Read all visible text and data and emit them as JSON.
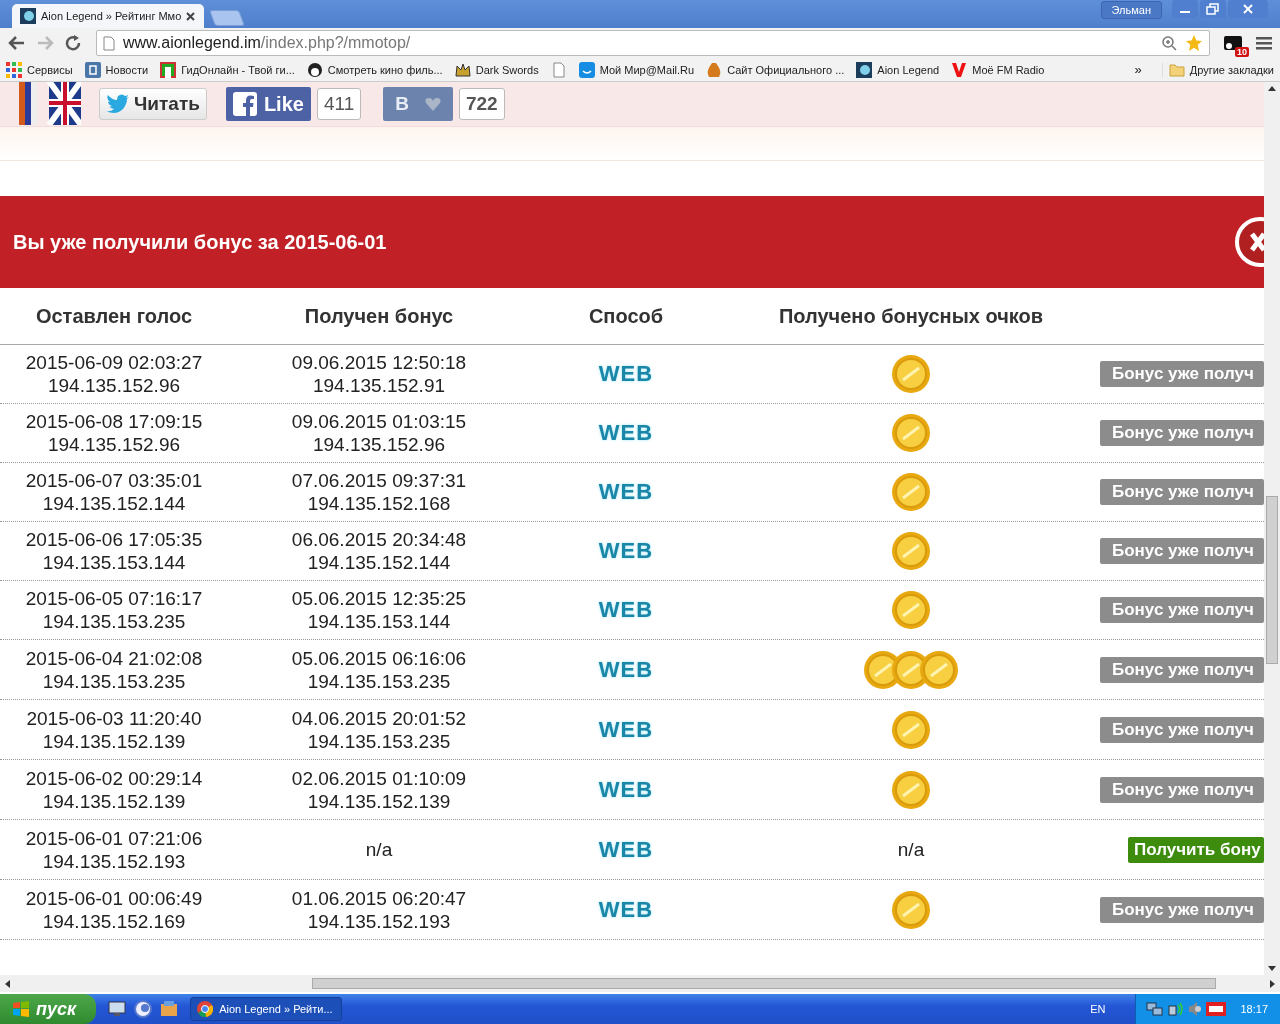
{
  "window": {
    "tab_title": "Aion Legend » Рейтинг Ммо",
    "user": "Эльман"
  },
  "toolbar": {
    "url_host": "www.aionlegend.im",
    "url_path": "/index.php?/mmotop/",
    "extension_badge": "10"
  },
  "bookmarks": [
    {
      "kind": "link",
      "label": "Сервисы"
    },
    {
      "kind": "link",
      "label": "Новости"
    },
    {
      "kind": "link",
      "label": "ГидОнлайн - Твой ги..."
    },
    {
      "kind": "link",
      "label": "Смотреть кино филь..."
    },
    {
      "kind": "link",
      "label": "Dark Swords"
    },
    {
      "kind": "icon"
    },
    {
      "kind": "link",
      "label": "Мой Мир@Mail.Ru"
    },
    {
      "kind": "link",
      "label": "Сайт Официального ..."
    },
    {
      "kind": "link",
      "label": "Aion Legend"
    },
    {
      "kind": "link",
      "label": "Моё  FM Radio"
    }
  ],
  "bookmarks_more": "»",
  "other_bookmarks": "Другие закладки",
  "social": {
    "twitter": "Читать",
    "facebook": "Like",
    "facebook_count": "411",
    "vk": "В",
    "vk_count": "722"
  },
  "notice": "Вы уже получили бонус за 2015-06-01",
  "table": {
    "columns": [
      "Оставлен голос",
      "Получен бонус",
      "Способ",
      "Получено бонусных очков"
    ],
    "rows": [
      {
        "voted": "2015-06-09 02:03:27",
        "voted_ip": "194.135.152.96",
        "bonus": "09.06.2015 12:50:18",
        "bonus_ip": "194.135.152.91",
        "method": "WEB",
        "points": {
          "kind": "coins1"
        },
        "action": {
          "kind": "received",
          "label": "Бонус уже получ"
        }
      },
      {
        "voted": "2015-06-08 17:09:15",
        "voted_ip": "194.135.152.96",
        "bonus": "09.06.2015 01:03:15",
        "bonus_ip": "194.135.152.96",
        "method": "WEB",
        "points": {
          "kind": "coins1"
        },
        "action": {
          "kind": "received",
          "label": "Бонус уже получ"
        }
      },
      {
        "voted": "2015-06-07 03:35:01",
        "voted_ip": "194.135.152.144",
        "bonus": "07.06.2015 09:37:31",
        "bonus_ip": "194.135.152.168",
        "method": "WEB",
        "points": {
          "kind": "coins1"
        },
        "action": {
          "kind": "received",
          "label": "Бонус уже получ"
        }
      },
      {
        "voted": "2015-06-06 17:05:35",
        "voted_ip": "194.135.153.144",
        "bonus": "06.06.2015 20:34:48",
        "bonus_ip": "194.135.152.144",
        "method": "WEB",
        "points": {
          "kind": "coins1"
        },
        "action": {
          "kind": "received",
          "label": "Бонус уже получ"
        }
      },
      {
        "voted": "2015-06-05 07:16:17",
        "voted_ip": "194.135.153.235",
        "bonus": "05.06.2015 12:35:25",
        "bonus_ip": "194.135.153.144",
        "method": "WEB",
        "points": {
          "kind": "coins1"
        },
        "action": {
          "kind": "received",
          "label": "Бонус уже получ"
        }
      },
      {
        "voted": "2015-06-04 21:02:08",
        "voted_ip": "194.135.153.235",
        "bonus": "05.06.2015 06:16:06",
        "bonus_ip": "194.135.153.235",
        "method": "WEB",
        "points": {
          "kind": "coins3"
        },
        "action": {
          "kind": "received",
          "label": "Бонус уже получ"
        }
      },
      {
        "voted": "2015-06-03 11:20:40",
        "voted_ip": "194.135.152.139",
        "bonus": "04.06.2015 20:01:52",
        "bonus_ip": "194.135.153.235",
        "method": "WEB",
        "points": {
          "kind": "coins1"
        },
        "action": {
          "kind": "received",
          "label": "Бонус уже получ"
        }
      },
      {
        "voted": "2015-06-02 00:29:14",
        "voted_ip": "194.135.152.139",
        "bonus": "02.06.2015 01:10:09",
        "bonus_ip": "194.135.152.139",
        "method": "WEB",
        "points": {
          "kind": "coins1"
        },
        "action": {
          "kind": "received",
          "label": "Бонус уже получ"
        }
      },
      {
        "voted": "2015-06-01 07:21:06",
        "voted_ip": "194.135.152.193",
        "bonus": "n/a",
        "method": "WEB",
        "points": {
          "kind": "text",
          "text": "n/a"
        },
        "action": {
          "kind": "get",
          "label": "Получить бону"
        }
      },
      {
        "voted": "2015-06-01 00:06:49",
        "voted_ip": "194.135.152.169",
        "bonus": "01.06.2015 06:20:47",
        "bonus_ip": "194.135.152.193",
        "method": "WEB",
        "points": {
          "kind": "coins1"
        },
        "action": {
          "kind": "received",
          "label": "Бонус уже получ"
        }
      }
    ]
  },
  "taskbar": {
    "start": "пуск",
    "task": "Aion Legend » Рейти...",
    "lang": "EN",
    "clock": "18:17"
  }
}
